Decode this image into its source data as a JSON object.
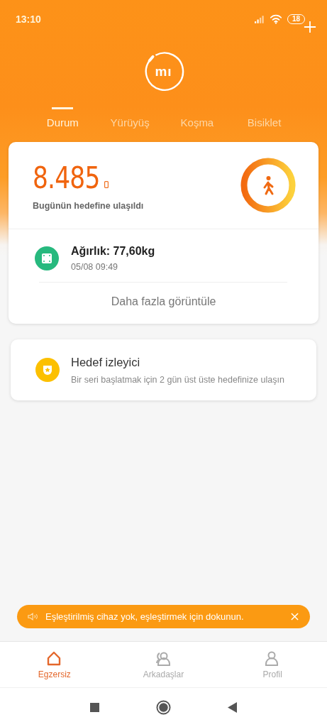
{
  "status_bar": {
    "time": "13:10",
    "battery": "18"
  },
  "header": {
    "logo": "mı"
  },
  "tabs": [
    {
      "label": "Durum",
      "selected": true
    },
    {
      "label": "Yürüyüş",
      "selected": false
    },
    {
      "label": "Koşma",
      "selected": false
    },
    {
      "label": "Bisiklet",
      "selected": false
    }
  ],
  "steps_card": {
    "steps": "8.485",
    "caption": "Bugünün hedefine ulaşıldı",
    "level": 1,
    "weight": {
      "title": "Ağırlık: 77,60kg",
      "date": "05/08 09:49"
    },
    "more_link": "Daha fazla görüntüle"
  },
  "goal_card": {
    "title": "Hedef izleyici",
    "subtitle": "Bir seri başlatmak için 2 gün üst üste hedefinize ulaşın"
  },
  "banner": {
    "text": "Eşleştirilmiş cihaz yok, eşleştirmek için dokunun."
  },
  "bottom_nav": [
    {
      "label": "Egzersiz",
      "kind": "home",
      "selected": true
    },
    {
      "label": "Arkadaşlar",
      "kind": "friends",
      "selected": false
    },
    {
      "label": "Profil",
      "kind": "profile",
      "selected": false
    }
  ]
}
